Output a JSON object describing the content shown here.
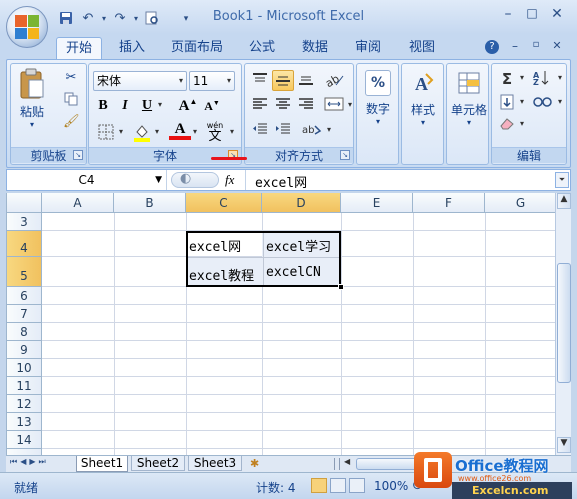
{
  "window": {
    "title": "Book1 - Microsoft Excel"
  },
  "tabs": [
    "开始",
    "插入",
    "页面布局",
    "公式",
    "数据",
    "审阅",
    "视图"
  ],
  "ribbon": {
    "clipboard": {
      "label": "剪贴板",
      "paste": "粘贴"
    },
    "font": {
      "label": "字体",
      "name": "宋体",
      "size": "11",
      "bold": "B",
      "italic": "I",
      "underline": "U",
      "grow": "A",
      "shrink": "A",
      "font_color": "A",
      "phonetic": "wén"
    },
    "alignment": {
      "label": "对齐方式"
    },
    "number": {
      "label": "数字",
      "symbol": "%"
    },
    "styles": {
      "label": "样式"
    },
    "cells": {
      "label": "单元格"
    },
    "editing": {
      "label": "编辑",
      "sum": "Σ"
    }
  },
  "formula_bar": {
    "name_box": "C4",
    "fx": "fx",
    "content": "excel网"
  },
  "grid": {
    "columns": [
      "A",
      "B",
      "C",
      "D",
      "E",
      "F",
      "G"
    ],
    "rows": [
      "3",
      "4",
      "5",
      "6",
      "7",
      "8",
      "9",
      "10",
      "11",
      "12",
      "13",
      "14"
    ],
    "cells": {
      "C4": "excel网",
      "D4": "excel学习",
      "C5": "excel教程",
      "D5": "excelCN"
    }
  },
  "sheets": [
    "Sheet1",
    "Sheet2",
    "Sheet3"
  ],
  "status": {
    "ready": "就绪",
    "count": "计数: 4",
    "zoom": "100%"
  },
  "watermark": {
    "brand": "Office教程网",
    "url": "www.office26.com",
    "site": "Excelcn.com"
  }
}
